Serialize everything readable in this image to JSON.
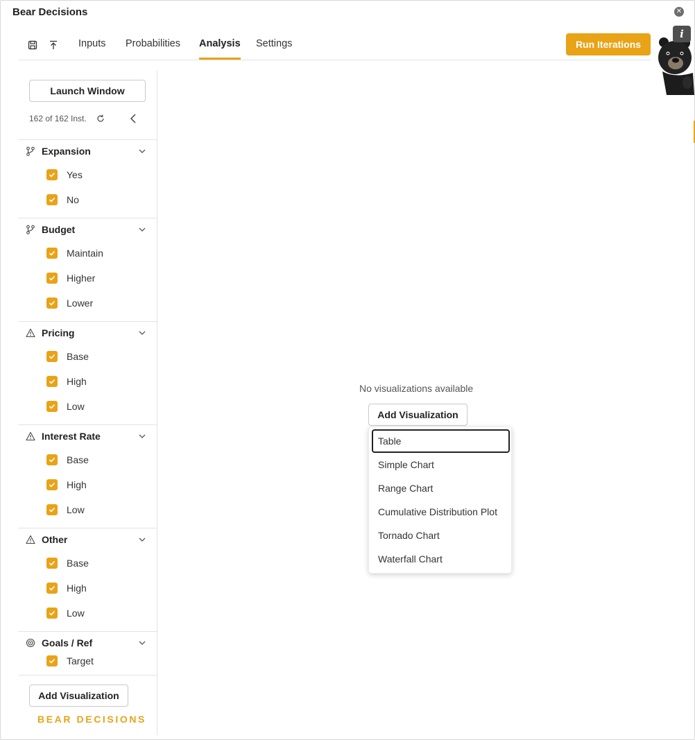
{
  "app": {
    "title": "Bear Decisions"
  },
  "tabs": [
    {
      "label": "Inputs"
    },
    {
      "label": "Probabilities"
    },
    {
      "label": "Analysis",
      "active": true
    },
    {
      "label": "Settings"
    }
  ],
  "toolbar": {
    "save_icon": "save-icon",
    "export_icon": "upload-icon",
    "run_label": "Run Iterations",
    "info_label": "i"
  },
  "sidebar": {
    "launch_label": "Launch Window",
    "instance_count": "162 of 162 Inst.",
    "sections": [
      {
        "title": "Expansion",
        "icon": "branch-icon",
        "options": [
          {
            "label": "Yes",
            "checked": true
          },
          {
            "label": "No",
            "checked": true
          }
        ]
      },
      {
        "title": "Budget",
        "icon": "branch-icon",
        "options": [
          {
            "label": "Maintain",
            "checked": true
          },
          {
            "label": "Higher",
            "checked": true
          },
          {
            "label": "Lower",
            "checked": true
          }
        ]
      },
      {
        "title": "Pricing",
        "icon": "warning-icon",
        "options": [
          {
            "label": "Base",
            "checked": true
          },
          {
            "label": "High",
            "checked": true
          },
          {
            "label": "Low",
            "checked": true
          }
        ]
      },
      {
        "title": "Interest Rate",
        "icon": "warning-icon",
        "options": [
          {
            "label": "Base",
            "checked": true
          },
          {
            "label": "High",
            "checked": true
          },
          {
            "label": "Low",
            "checked": true
          }
        ]
      },
      {
        "title": "Other",
        "icon": "warning-icon",
        "options": [
          {
            "label": "Base",
            "checked": true
          },
          {
            "label": "High",
            "checked": true
          },
          {
            "label": "Low",
            "checked": true
          }
        ]
      },
      {
        "title": "Goals / Ref",
        "icon": "target-icon",
        "options": [
          {
            "label": "Target",
            "checked": true
          }
        ]
      }
    ],
    "add_visualization_label": "Add Visualization",
    "brand": "BEAR DECISIONS"
  },
  "main": {
    "empty_text": "No visualizations available",
    "add_visualization_label": "Add Visualization",
    "menu_items": [
      {
        "label": "Table",
        "focused": true
      },
      {
        "label": "Simple Chart"
      },
      {
        "label": "Range Chart"
      },
      {
        "label": "Cumulative Distribution Plot"
      },
      {
        "label": "Tornado Chart"
      },
      {
        "label": "Waterfall Chart"
      }
    ]
  },
  "colors": {
    "accent": "#e8a317",
    "border": "#e3e3e3",
    "text": "#222222"
  }
}
